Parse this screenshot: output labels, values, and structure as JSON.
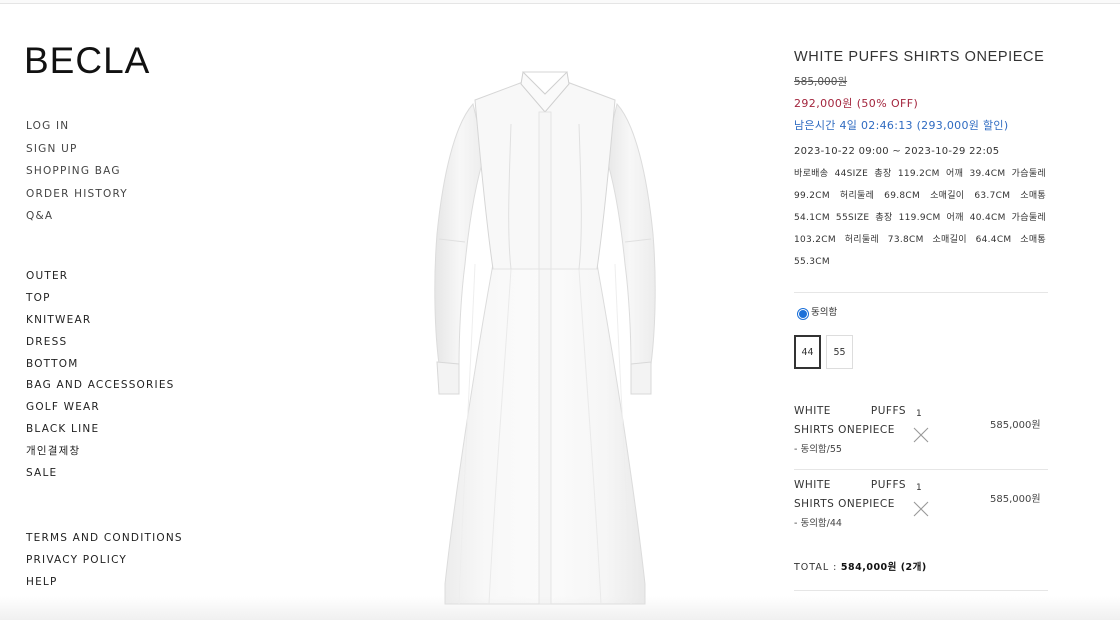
{
  "brand": {
    "logo": "BECLA"
  },
  "nav": {
    "account": [
      "LOG IN",
      "SIGN UP",
      "SHOPPING BAG",
      "ORDER HISTORY",
      "Q&A"
    ],
    "categories": [
      "OUTER",
      "TOP",
      "KNITWEAR",
      "DRESS",
      "BOTTOM",
      "BAG AND ACCESSORIES",
      "GOLF WEAR",
      "BLACK LINE",
      "개인결제창",
      "SALE"
    ],
    "footer": [
      "TERMS AND CONDITIONS",
      "PRIVACY POLICY",
      "HELP"
    ]
  },
  "product": {
    "title": "WHITE PUFFS SHIRTS ONEPIECE",
    "original_price": "585,000원",
    "sale_price": "292,000원 (50% OFF)",
    "timer": "남은시간 4일 02:46:13 (293,000원 할인)",
    "period": "2023-10-22 09:00 ~ 2023-10-29 22:05",
    "description": "바로배송 44SIZE 총장 119.2CM 어깨 39.4CM 가슴둘레 99.2CM 허리둘레 69.8CM 소매길이 63.7CM 소매통 54.1CM 55SIZE 총장 119.9CM 어깨 40.4CM 가슴둘레 103.2CM 허리둘레 73.8CM 소매길이 64.4CM 소매통 55.3CM",
    "image_alt": "white-shirt-dress"
  },
  "options": {
    "agree_label": "동의함",
    "agree_checked": true,
    "sizes": [
      "44",
      "55"
    ],
    "selected_size": "44"
  },
  "cart": {
    "items": [
      {
        "name": "WHITE PUFFS SHIRTS ONEPIECE",
        "option": "- 동의함/55",
        "qty": "1",
        "price": "585,000원"
      },
      {
        "name": "WHITE PUFFS SHIRTS ONEPIECE",
        "option": "- 동의함/44",
        "qty": "1",
        "price": "585,000원"
      }
    ],
    "total_label": "TOTAL :",
    "total_value": "584,000원 (2개)"
  },
  "colors": {
    "sale": "#a3253d",
    "timer": "#2f6bc1",
    "radio": "#1a6fd8"
  }
}
